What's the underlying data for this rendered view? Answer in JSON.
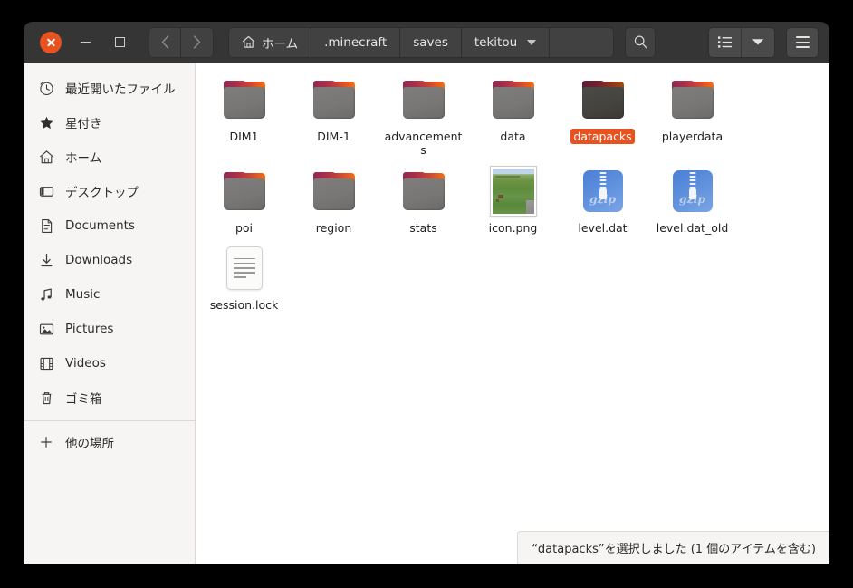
{
  "window": {
    "controls": {
      "close_label": "close-button",
      "minimize_label": "minimize-button",
      "maximize_label": "maximize-button"
    },
    "nav": {
      "back": "‹",
      "forward": "›"
    }
  },
  "breadcrumb": {
    "items": [
      {
        "label": "ホーム",
        "icon": "home-icon",
        "has_caret": false
      },
      {
        "label": ".minecraft",
        "icon": "",
        "has_caret": false
      },
      {
        "label": "saves",
        "icon": "",
        "has_caret": false
      },
      {
        "label": "tekitou",
        "icon": "",
        "has_caret": true
      }
    ]
  },
  "toolbar": {
    "search_icon": "search-icon",
    "view_list_icon": "list-view-icon",
    "view_dropdown_icon": "chevron-down-icon",
    "menu_icon": "hamburger-menu-icon"
  },
  "sidebar": {
    "items": [
      {
        "label": "最近開いたファイル",
        "icon": "clock-icon"
      },
      {
        "label": "星付き",
        "icon": "star-icon"
      },
      {
        "label": "ホーム",
        "icon": "home-icon"
      },
      {
        "label": "デスクトップ",
        "icon": "desktop-icon"
      },
      {
        "label": "Documents",
        "icon": "document-icon"
      },
      {
        "label": "Downloads",
        "icon": "download-icon"
      },
      {
        "label": "Music",
        "icon": "music-note-icon"
      },
      {
        "label": "Pictures",
        "icon": "picture-icon"
      },
      {
        "label": "Videos",
        "icon": "film-icon"
      },
      {
        "label": "ゴミ箱",
        "icon": "trash-icon"
      }
    ],
    "other_locations": {
      "label": "他の場所",
      "icon": "plus-icon"
    }
  },
  "files": [
    {
      "name": "DIM1",
      "type": "folder",
      "selected": false
    },
    {
      "name": "DIM-1",
      "type": "folder",
      "selected": false
    },
    {
      "name": "advancements",
      "type": "folder",
      "selected": false
    },
    {
      "name": "data",
      "type": "folder",
      "selected": false
    },
    {
      "name": "datapacks",
      "type": "folder",
      "selected": true
    },
    {
      "name": "playerdata",
      "type": "folder",
      "selected": false
    },
    {
      "name": "poi",
      "type": "folder",
      "selected": false
    },
    {
      "name": "region",
      "type": "folder",
      "selected": false
    },
    {
      "name": "stats",
      "type": "folder",
      "selected": false
    },
    {
      "name": "icon.png",
      "type": "image",
      "selected": false
    },
    {
      "name": "level.dat",
      "type": "gzip",
      "selected": false,
      "icon_text": "gzip"
    },
    {
      "name": "level.dat_old",
      "type": "gzip",
      "selected": false,
      "icon_text": "gzip"
    },
    {
      "name": "session.lock",
      "type": "document",
      "selected": false
    }
  ],
  "statusbar": {
    "text": "“datapacks”を選択しました (1 個のアイテムを含む)"
  },
  "colors": {
    "accent": "#e9521e",
    "titlebar": "#353535",
    "sidebar": "#f6f5f4",
    "fileview": "#ffffff"
  }
}
